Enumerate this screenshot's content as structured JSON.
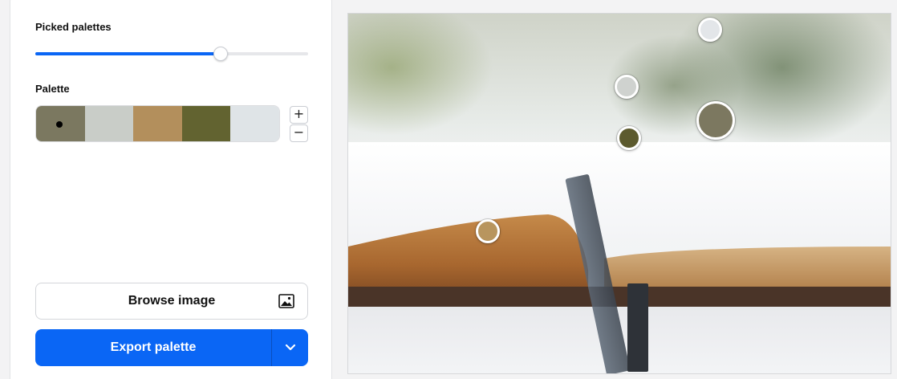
{
  "controls": {
    "picked_label": "Picked palettes",
    "picked_value_fraction": 0.68,
    "palette_label": "Palette",
    "add_label": "+",
    "remove_label": "−"
  },
  "palette": {
    "colors": [
      "#7b7860",
      "#c9cdc8",
      "#b38f5c",
      "#626330",
      "#dfe4e7"
    ],
    "selected_index": 0
  },
  "actions": {
    "browse_label": "Browse image",
    "export_label": "Export palette"
  },
  "accent_color": "#0a66f5",
  "image": {
    "subject": "open book with ribbon bookmark, plants in background",
    "pickers": [
      {
        "color": "#e3e6e9"
      },
      {
        "color": "#cfd2cf"
      },
      {
        "color": "#7c7860"
      },
      {
        "color": "#5c5a2e"
      },
      {
        "color": "#b8955e"
      }
    ]
  }
}
